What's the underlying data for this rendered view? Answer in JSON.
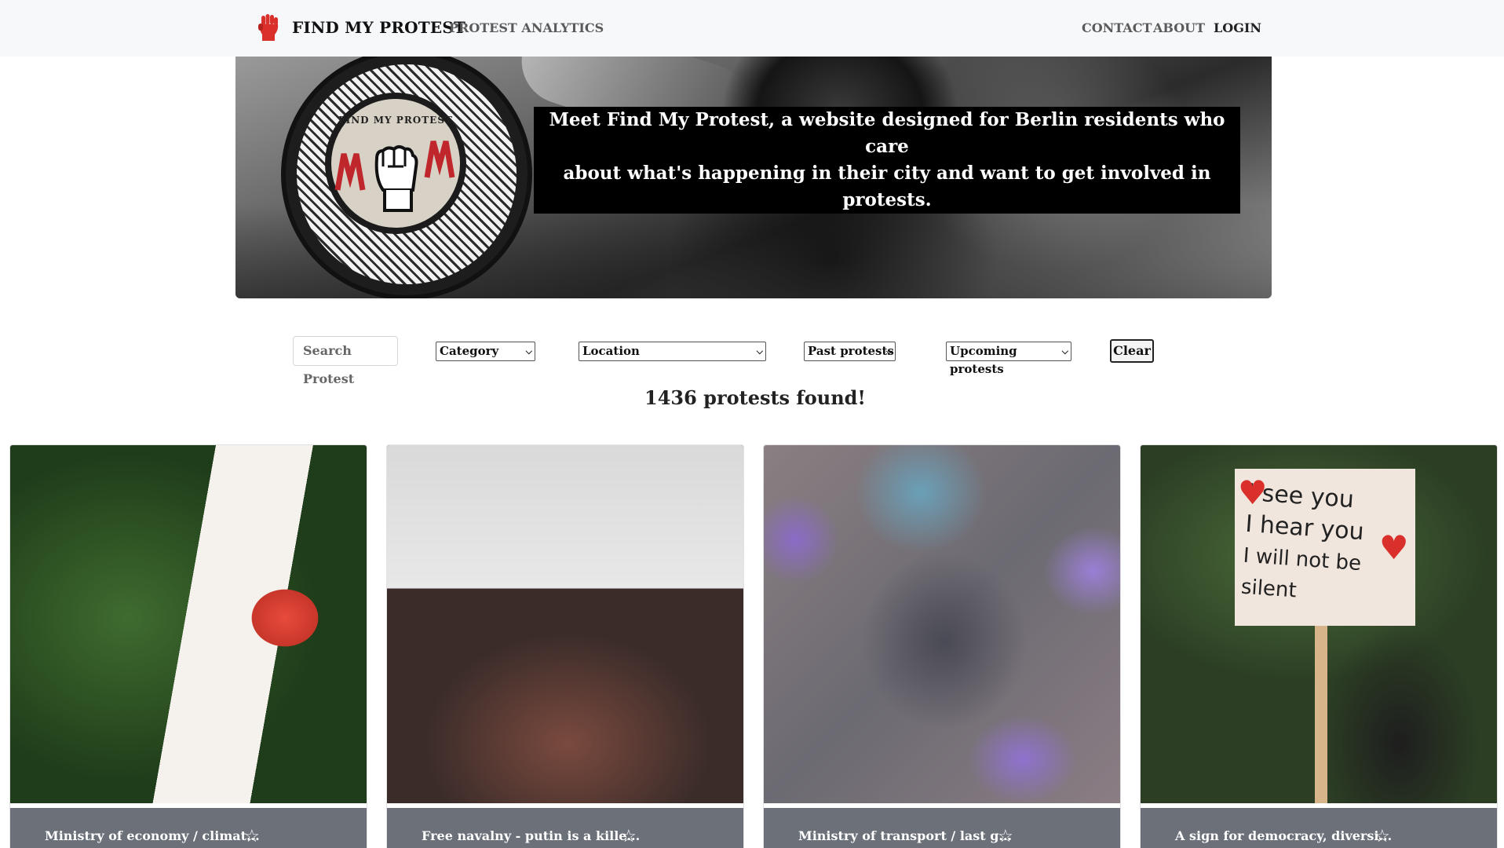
{
  "nav": {
    "brand": "FIND MY PROTEST",
    "analytics": "PROTEST ANALYTICS",
    "contact": "CONTACT",
    "about": "ABOUT",
    "login": "LOGIN"
  },
  "hero": {
    "logo_text": "FIND MY PROTEST",
    "line1": "Meet Find My Protest, a website designed for Berlin residents who care",
    "line2": "about what's happening in their city and want to get involved in protests."
  },
  "filters": {
    "search_placeholder": "Search Protest",
    "category": "Category",
    "location": "Location",
    "past": "Past protests",
    "upcoming": "Upcoming protests",
    "clear": "Clear"
  },
  "results": {
    "count_text": "1436 protests found!"
  },
  "cards": [
    {
      "title": "Ministry of economy / climat..."
    },
    {
      "title": "Free navalny - putin is a kille..."
    },
    {
      "title": "Ministry of transport / last g..."
    },
    {
      "title": "A sign for democracy, diversi..."
    }
  ],
  "card4_sign": {
    "line1": "I see you",
    "line2": "I hear you",
    "line3": "I will not be silent"
  },
  "colors": {
    "accent_red": "#d9302c",
    "card_footer": "#6b7079",
    "navbar_bg": "#f7f8fa"
  },
  "icons": {
    "brand": "raised-fist-icon",
    "favorite": "star-outline-icon",
    "select_arrow": "chevron-down-icon"
  }
}
